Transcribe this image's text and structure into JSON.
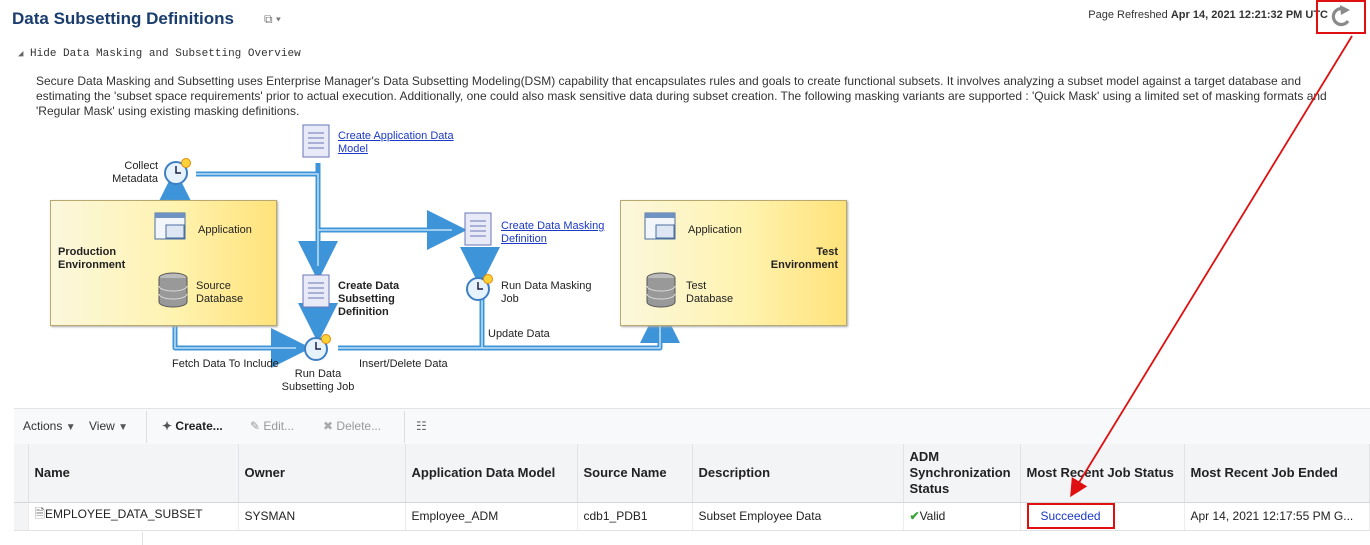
{
  "page": {
    "title": "Data Subsetting Definitions",
    "refreshed_label": "Page Refreshed",
    "refreshed_time": "Apr 14, 2021 12:21:32 PM UTC"
  },
  "overview": {
    "toggle_label": "Hide Data Masking and Subsetting Overview",
    "description": "Secure Data Masking and Subsetting uses Enterprise Manager's Data Subsetting Modeling(DSM) capability that encapsulates rules and goals to create functional subsets. It involves analyzing a subset model against a target database and estimating the 'subset space requirements' prior to actual execution. Additionally, one could also mask sensitive data during subset creation. The following masking variants are supported : 'Quick Mask' using a limited set of masking formats and 'Regular Mask' using existing masking definitions."
  },
  "diagram": {
    "collect_metadata": [
      "Collect",
      "Metadata"
    ],
    "create_adm": [
      "Create Application Data",
      "Model"
    ],
    "production_env": [
      "Production",
      "Environment"
    ],
    "application": "Application",
    "source_db": [
      "Source",
      "Database"
    ],
    "create_subsetting_def": [
      "Create Data",
      "Subsetting",
      "Definition"
    ],
    "create_masking_def": [
      "Create Data Masking",
      "Definition"
    ],
    "run_masking_job": [
      "Run Data Masking",
      "Job"
    ],
    "test_env": [
      "Test",
      "Environment"
    ],
    "test_application": "Application",
    "test_db": [
      "Test",
      "Database"
    ],
    "update_data": "Update Data",
    "fetch_data": "Fetch Data To Include",
    "run_subsetting_job": [
      "Run Data",
      "Subsetting Job"
    ],
    "insert_delete": "Insert/Delete Data"
  },
  "toolbar": {
    "actions": "Actions",
    "view": "View",
    "create": "Create...",
    "edit": "Edit...",
    "delete": "Delete..."
  },
  "table": {
    "headers": [
      "Name",
      "Owner",
      "Application Data Model",
      "Source Name",
      "Description",
      "ADM Synchronization Status",
      "Most Recent Job Status",
      "Most Recent Job Ended"
    ],
    "rows": [
      {
        "name": "EMPLOYEE_DATA_SUBSET",
        "owner": "SYSMAN",
        "adm": "Employee_ADM",
        "source": "cdb1_PDB1",
        "description": "Subset Employee Data",
        "sync_status": "Valid",
        "job_status": "Succeeded",
        "job_ended": "Apr 14, 2021 12:17:55 PM G..."
      }
    ]
  },
  "colors": {
    "title": "#1a3d6e",
    "link": "#1b39c4",
    "highlight": "#e01010",
    "arrow": "#5aaae6"
  }
}
